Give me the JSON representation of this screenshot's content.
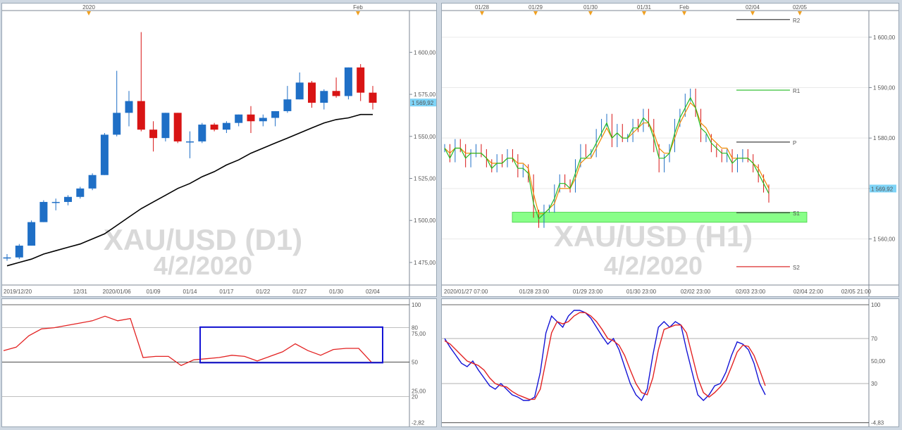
{
  "colors": {
    "bull": "#1f6fc6",
    "bear": "#d81414",
    "ma": "#000000",
    "ind_red": "#e32222",
    "ind_blue": "#1414d6",
    "green": "#22bb22",
    "orange": "#ee8800",
    "zone": "#88ff88",
    "price_tag": "#7fd4f7"
  },
  "chart_data": [
    {
      "type": "candlestick",
      "watermark": {
        "symbol": "XAU/USD (D1)",
        "date": "4/2/2020"
      },
      "top_labels": [
        "2020",
        "Feb"
      ],
      "x_tick_labels": [
        "2019/12/20",
        "12/31",
        "2020/01/06",
        "01/09",
        "01/14",
        "01/17",
        "01/22",
        "01/27",
        "01/30",
        "02/04"
      ],
      "y_tick_labels": [
        "1 600,00",
        "1 575,00",
        "1 550,00",
        "1 525,00",
        "1 500,00",
        "1 475,00"
      ],
      "ylim": [
        1462,
        1624
      ],
      "last_price": "1 569,92",
      "candles": [
        [
          1478,
          1480,
          1476,
          1478
        ],
        [
          1478,
          1486,
          1477,
          1485
        ],
        [
          1485,
          1500,
          1485,
          1499
        ],
        [
          1499,
          1512,
          1499,
          1511
        ],
        [
          1511,
          1513,
          1506,
          1511
        ],
        [
          1511,
          1515,
          1509,
          1514
        ],
        [
          1514,
          1520,
          1513,
          1519
        ],
        [
          1519,
          1528,
          1518,
          1527
        ],
        [
          1527,
          1552,
          1527,
          1551
        ],
        [
          1551,
          1589,
          1550,
          1564
        ],
        [
          1564,
          1577,
          1556,
          1571
        ],
        [
          1571,
          1612,
          1553,
          1554
        ],
        [
          1554,
          1559,
          1541,
          1549
        ],
        [
          1549,
          1564,
          1547,
          1564
        ],
        [
          1564,
          1564,
          1546,
          1547
        ],
        [
          1547,
          1553,
          1537,
          1547
        ],
        [
          1547,
          1558,
          1546,
          1557
        ],
        [
          1557,
          1558,
          1553,
          1554
        ],
        [
          1554,
          1559,
          1552,
          1558
        ],
        [
          1558,
          1563,
          1556,
          1563
        ],
        [
          1563,
          1568,
          1552,
          1559
        ],
        [
          1559,
          1563,
          1556,
          1561
        ],
        [
          1561,
          1565,
          1556,
          1565
        ],
        [
          1565,
          1580,
          1564,
          1572
        ],
        [
          1572,
          1588,
          1572,
          1582
        ],
        [
          1582,
          1583,
          1567,
          1570
        ],
        [
          1570,
          1578,
          1566,
          1577
        ],
        [
          1577,
          1585,
          1573,
          1574
        ],
        [
          1574,
          1591,
          1572,
          1591
        ],
        [
          1591,
          1593,
          1571,
          1576
        ],
        [
          1576,
          1580,
          1566,
          1570
        ]
      ],
      "ma": [
        1473,
        1475,
        1477,
        1480,
        1482,
        1484,
        1486,
        1489,
        1492,
        1497,
        1502,
        1507,
        1511,
        1515,
        1519,
        1522,
        1526,
        1529,
        1533,
        1536,
        1540,
        1543,
        1546,
        1549,
        1552,
        1555,
        1558,
        1560,
        1561,
        1563,
        1563
      ]
    },
    {
      "type": "line",
      "y_tick_labels": [
        "100",
        "80",
        "75,00",
        "50",
        "25,00",
        "20",
        "-2,82"
      ],
      "ylim": [
        -3,
        100
      ],
      "values": [
        60,
        63,
        73,
        79,
        80,
        82,
        84,
        86,
        90,
        86,
        88,
        54,
        55,
        55,
        47,
        52,
        53,
        54,
        56,
        55,
        51,
        55,
        59,
        66,
        60,
        56,
        61,
        62,
        62,
        50
      ]
    },
    {
      "type": "line",
      "watermark": {
        "symbol": "XAU/USD (H1)",
        "date": "4/2/2020"
      },
      "top_labels": [
        "01/28",
        "01/29",
        "01/30",
        "01/31",
        "Feb",
        "02/04",
        "02/05"
      ],
      "x_tick_labels": [
        "2020/01/27 07:00",
        "01/28 23:00",
        "01/29 23:00",
        "01/30 23:00",
        "02/02 23:00",
        "02/03 23:00",
        "02/04 22:00",
        "02/05 21:00"
      ],
      "y_tick_labels": [
        "1 600,00",
        "1 590,00",
        "1 580,00",
        "1 570,00",
        "1 560,00"
      ],
      "ylim": [
        1551,
        1605
      ],
      "last_price": "1 569,92",
      "pivot_labels": [
        "R2",
        "R1",
        "P",
        "S1",
        "S2"
      ],
      "pivot_levels": [
        1603.5,
        1589.5,
        1579.2,
        1565.2,
        1554.5
      ],
      "close": [
        1578,
        1576,
        1579,
        1578,
        1575,
        1577,
        1578,
        1577,
        1575,
        1574,
        1576,
        1575,
        1577,
        1576,
        1573,
        1574,
        1572,
        1565,
        1563,
        1566,
        1566,
        1570,
        1572,
        1571,
        1570,
        1575,
        1578,
        1577,
        1577,
        1581,
        1583,
        1584,
        1579,
        1582,
        1580,
        1580,
        1583,
        1582,
        1585,
        1583,
        1578,
        1574,
        1576,
        1578,
        1583,
        1585,
        1588,
        1589,
        1585,
        1580,
        1580,
        1578,
        1577,
        1576,
        1577,
        1574,
        1576,
        1577,
        1576,
        1574,
        1572,
        1570,
        1568
      ],
      "ema_fast": [
        1578,
        1576,
        1578,
        1578,
        1576,
        1577,
        1577,
        1577,
        1576,
        1574,
        1575,
        1575,
        1576,
        1576,
        1574,
        1574,
        1573,
        1567,
        1564,
        1565,
        1566,
        1568,
        1571,
        1571,
        1570,
        1573,
        1576,
        1576,
        1577,
        1579,
        1581,
        1583,
        1580,
        1581,
        1580,
        1580,
        1582,
        1582,
        1584,
        1583,
        1580,
        1576,
        1576,
        1577,
        1581,
        1584,
        1586,
        1588,
        1586,
        1582,
        1581,
        1579,
        1578,
        1577,
        1577,
        1575,
        1576,
        1576,
        1576,
        1575,
        1573,
        1571,
        1569
      ],
      "ema_slow": [
        1578,
        1577,
        1578,
        1578,
        1577,
        1577,
        1577,
        1577,
        1576,
        1575,
        1575,
        1575,
        1576,
        1576,
        1575,
        1575,
        1574,
        1569,
        1565,
        1565,
        1566,
        1567,
        1570,
        1570,
        1570,
        1572,
        1575,
        1576,
        1576,
        1578,
        1580,
        1582,
        1580,
        1581,
        1580,
        1580,
        1581,
        1582,
        1583,
        1583,
        1581,
        1578,
        1577,
        1577,
        1580,
        1583,
        1585,
        1587,
        1586,
        1583,
        1582,
        1580,
        1579,
        1578,
        1578,
        1576,
        1576,
        1576,
        1576,
        1575,
        1574,
        1572,
        1570
      ]
    },
    {
      "type": "line",
      "y_tick_labels": [
        "100",
        "70",
        "50,00",
        "30",
        "-4,83"
      ],
      "ylim": [
        -5,
        100
      ],
      "k": [
        70,
        62,
        55,
        48,
        45,
        50,
        42,
        35,
        28,
        25,
        30,
        25,
        20,
        18,
        15,
        15,
        18,
        40,
        75,
        90,
        85,
        80,
        90,
        95,
        95,
        93,
        88,
        80,
        72,
        65,
        70,
        60,
        45,
        30,
        20,
        15,
        25,
        55,
        80,
        85,
        80,
        85,
        82,
        60,
        40,
        20,
        15,
        20,
        28,
        30,
        40,
        55,
        67,
        65,
        60,
        48,
        30,
        20
      ],
      "d": [
        68,
        65,
        60,
        55,
        50,
        48,
        46,
        42,
        35,
        30,
        28,
        27,
        23,
        20,
        18,
        16,
        16,
        25,
        50,
        75,
        85,
        83,
        85,
        90,
        93,
        93,
        90,
        85,
        78,
        70,
        68,
        64,
        55,
        42,
        30,
        22,
        20,
        35,
        60,
        78,
        80,
        82,
        82,
        75,
        55,
        35,
        22,
        18,
        22,
        27,
        33,
        45,
        58,
        64,
        63,
        55,
        42,
        28
      ]
    }
  ]
}
